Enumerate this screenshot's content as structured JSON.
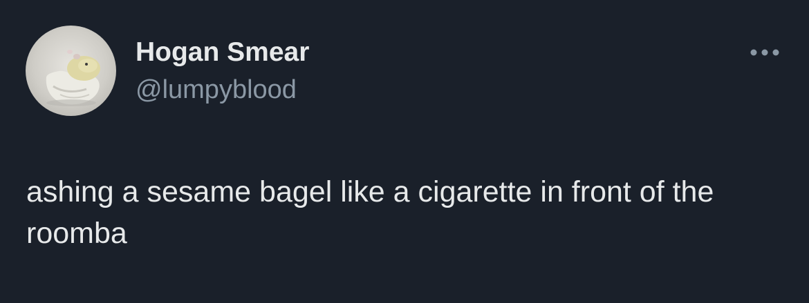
{
  "author": {
    "display_name": "Hogan Smear",
    "handle": "@lumpyblood",
    "avatar_icon": "plush-toy-avatar"
  },
  "menu": {
    "icon": "more-horizontal-icon"
  },
  "tweet": {
    "text": "ashing a sesame bagel like a cigarette in front of the roomba"
  },
  "colors": {
    "background": "#1a202a",
    "primary_text": "#e7e9ea",
    "secondary_text": "#8b98a5"
  }
}
